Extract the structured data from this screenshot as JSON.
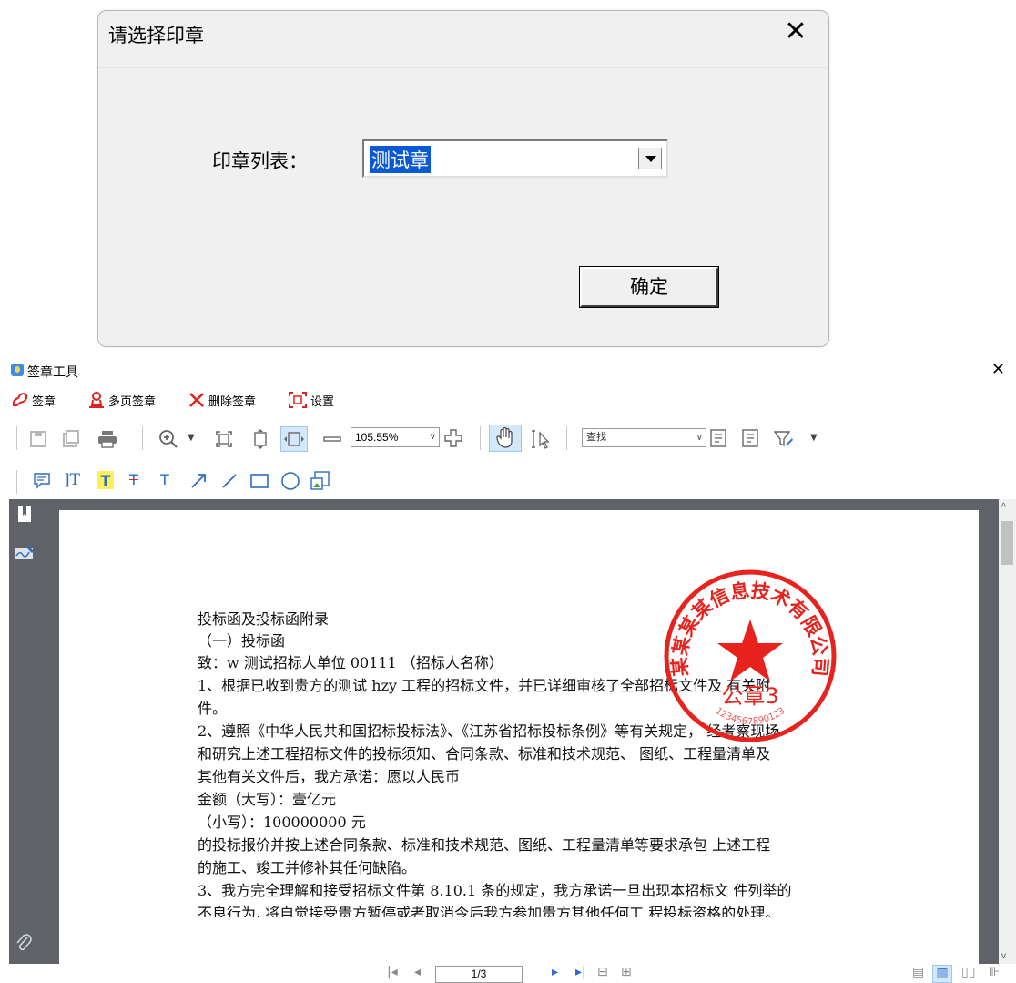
{
  "dialog": {
    "title": "请选择印章",
    "seal_list_label": "印章列表：",
    "seal_selected": "测试章",
    "ok_label": "确定"
  },
  "window": {
    "title": "签章工具"
  },
  "menu": {
    "sign": "签章",
    "multi_sign": "多页签章",
    "delete_sign": "删除签章",
    "settings": "设置"
  },
  "toolbar": {
    "zoom_value": "105.55%",
    "find_placeholder": "查找"
  },
  "document": {
    "lines": [
      "投标函及投标函附录",
      "（一）投标函",
      "致：w 测试招标人单位 00111 （招标人名称）",
      "1、根据已收到贵方的测试 hzy 工程的招标文件，并已详细审核了全部招标文件及 有关附",
      "件。",
      "2、遵照《中华人民共和国招标投标法》、《江苏省招标投标条例》等有关规定， 经考察现场",
      "和研究上述工程招标文件的投标须知、合同条款、标准和技术规范、 图纸、工程量清单及",
      "其他有关文件后，我方承诺：愿以人民币",
      "金额（大写）：壹亿元",
      "（小写）：100000000 元",
      "的投标报价并按上述合同条款、标准和技术规范、图纸、工程量清单等要求承包 上述工程",
      "的施工、竣工并修补其任何缺陷。",
      "3、我方完全理解和接受招标文件第 8.10.1 条的规定，我方承诺一旦出现本招标文 件列举的",
      "不良行为, 将自觉接受贵方暂停或者取消今后我方参加贵方其他任何工 程投标资格的处理。"
    ],
    "seal": {
      "company": "某某某某信息技术有限公司",
      "name": "公章3",
      "code": "1234567890123",
      "color": "#e8231e"
    }
  },
  "status": {
    "page_indicator": "1/3"
  }
}
